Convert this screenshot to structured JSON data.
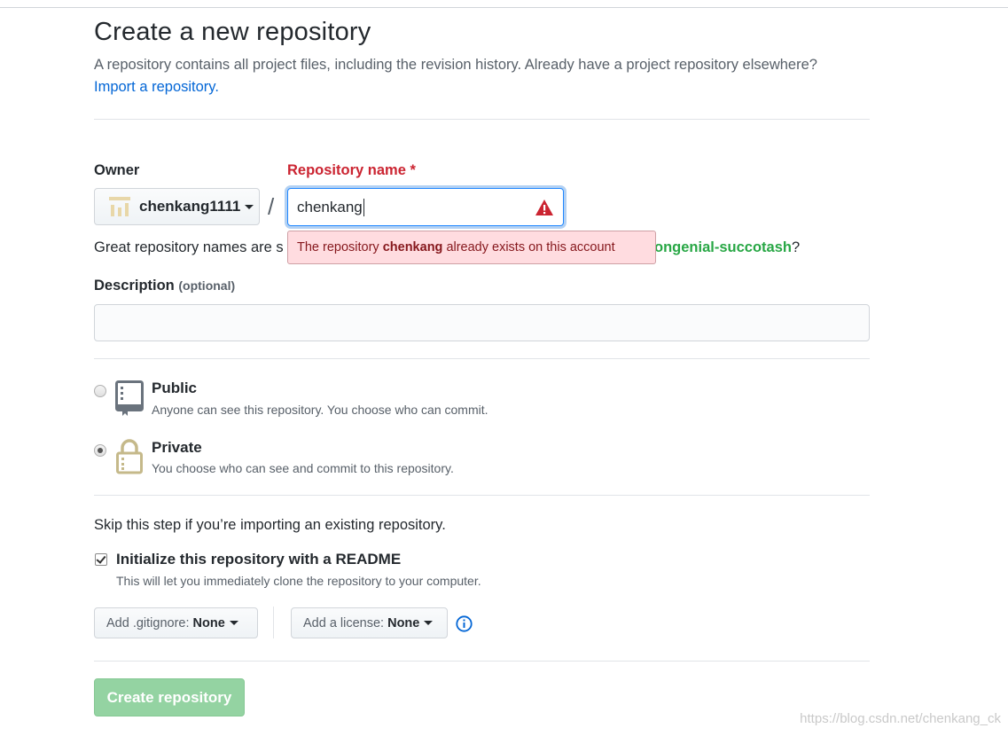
{
  "header": {
    "title": "Create a new repository",
    "subtitle": "A repository contains all project files, including the revision history. Already have a project repository elsewhere?",
    "import_link": "Import a repository."
  },
  "owner": {
    "label": "Owner",
    "value": "chenkang1111"
  },
  "repo_name": {
    "label": "Repository name",
    "required_mark": "*",
    "value": "chenkang",
    "separator": "/"
  },
  "name_hint": {
    "prefix": "Great repository names are s",
    "suggestion": "ongenial-succotash",
    "suffix": "?"
  },
  "error_tooltip": {
    "before": "The repository ",
    "name": "chenkang",
    "after": " already exists on this account"
  },
  "description": {
    "label": "Description",
    "optional": "(optional)",
    "value": ""
  },
  "visibility": {
    "selected": "private",
    "options": [
      {
        "id": "public",
        "title": "Public",
        "note": "Anyone can see this repository. You choose who can commit.",
        "icon": "repo-book-icon"
      },
      {
        "id": "private",
        "title": "Private",
        "note": "You choose who can see and commit to this repository.",
        "icon": "lock-icon"
      }
    ]
  },
  "init": {
    "skip_text": "Skip this step if you’re importing an existing repository.",
    "readme_label": "Initialize this repository with a README",
    "readme_note": "This will let you immediately clone the repository to your computer.",
    "readme_checked": true
  },
  "gitignore": {
    "label": "Add .gitignore:",
    "value": "None"
  },
  "license": {
    "label": "Add a license:",
    "value": "None"
  },
  "submit": {
    "label": "Create repository"
  },
  "watermark": "https://blog.csdn.net/chenkang_ck",
  "colors": {
    "link": "#0366d6",
    "error": "#cb2431",
    "success": "#28a745",
    "create_button": "#94d3a2"
  }
}
